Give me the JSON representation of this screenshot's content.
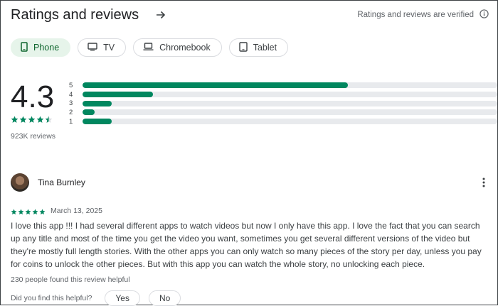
{
  "header": {
    "title": "Ratings and reviews",
    "arrow_icon": "arrow-forward-icon",
    "verified_text": "Ratings and reviews are verified",
    "info_icon": "info-icon"
  },
  "chips": [
    {
      "label": "Phone",
      "icon": "phone-icon",
      "selected": true
    },
    {
      "label": "TV",
      "icon": "tv-icon",
      "selected": false
    },
    {
      "label": "Chromebook",
      "icon": "laptop-icon",
      "selected": false
    },
    {
      "label": "Tablet",
      "icon": "tablet-icon",
      "selected": false
    }
  ],
  "summary": {
    "rating": "4.3",
    "stars": 4.5,
    "review_count": "923K reviews"
  },
  "distribution": [
    {
      "label": "5",
      "fraction": 0.64
    },
    {
      "label": "4",
      "fraction": 0.17
    },
    {
      "label": "3",
      "fraction": 0.07
    },
    {
      "label": "2",
      "fraction": 0.03
    },
    {
      "label": "1",
      "fraction": 0.07
    }
  ],
  "review": {
    "author": "Tina Burnley",
    "stars": 5,
    "date": "March 13, 2025",
    "text": "I love this app !!! I had several different apps to watch videos but now I only have this app. I love the fact that you can search up any title and most of the time you get the video you want, sometimes you get several different versions of the video but they're mostly full length stories. With the other apps you can only watch so many pieces of the story per day, unless you pay for coins to unlock the other pieces. But with this app you can watch the whole story, no unlocking each piece.",
    "helpful_count": "230 people found this review helpful",
    "helpful_question": "Did you find this helpful?",
    "yes_label": "Yes",
    "no_label": "No"
  },
  "colors": {
    "accent_green": "#01875f",
    "chip_selected_bg": "#e6f4ea",
    "chip_selected_text": "#0d652d",
    "bar_track": "#e8eaed"
  }
}
